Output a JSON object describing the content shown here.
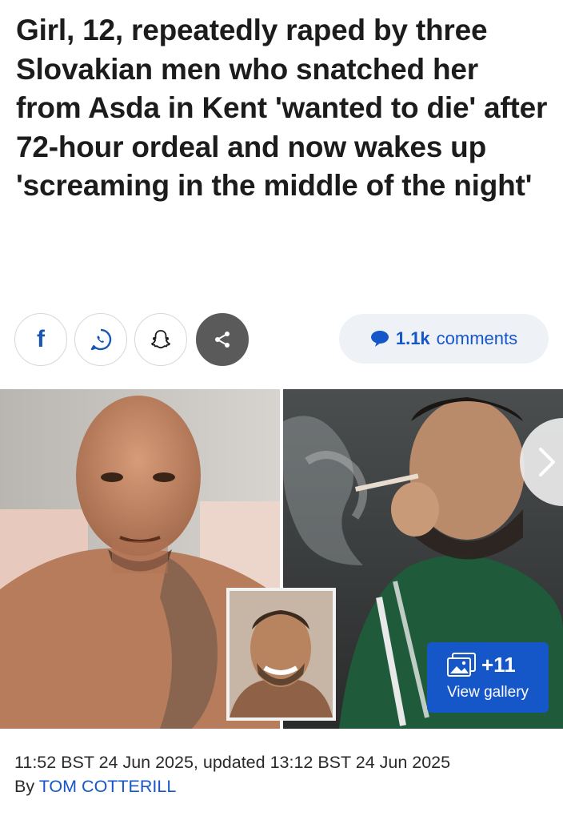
{
  "article": {
    "headline": "Girl, 12, repeatedly raped by three Slovakian men who snatched her from Asda in Kent 'wanted to die' after 72-hour ordeal and now wakes up 'screaming in the middle of the night'",
    "timestamp": "11:52 BST 24 Jun 2025, updated 13:12 BST 24 Jun 2025",
    "byline_prefix": "By",
    "author": "TOM COTTERILL"
  },
  "share": {
    "facebook_icon": "facebook-icon",
    "whatsapp_icon": "whatsapp-icon",
    "snapchat_icon": "snapchat-icon",
    "share_icon": "share-icon",
    "facebook_glyph": "f"
  },
  "comments": {
    "count": "1.1k",
    "label": "comments",
    "icon": "speech-bubble-icon"
  },
  "gallery": {
    "count": "+11",
    "label": "View gallery",
    "icon": "gallery-icon",
    "next_icon": "chevron-right-icon"
  },
  "colors": {
    "accent": "#1556c8",
    "pill_bg": "#eef1f6",
    "share_dark": "#5a5a5a"
  }
}
